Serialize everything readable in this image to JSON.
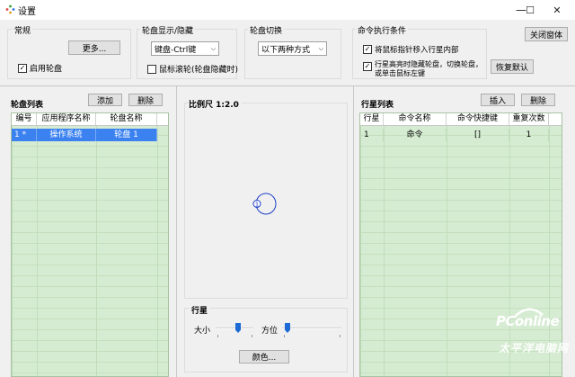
{
  "window": {
    "title": "设置",
    "minimize": "—",
    "maximize": "☐",
    "close": "✕"
  },
  "general": {
    "label": "常规",
    "more_button": "更多...",
    "enable_label": "启用轮盘",
    "enable_checked": true
  },
  "display": {
    "label": "轮盘显示/隐藏",
    "hotkey_value": "键盘-Ctrl键",
    "wheel_label": "鼠标滚轮(轮盘隐藏时)",
    "wheel_checked": false
  },
  "switch": {
    "label": "轮盘切换",
    "mode_value": "以下两种方式"
  },
  "exec": {
    "label": "命令执行条件",
    "opt1": "将鼠标指针移入行星内部",
    "opt1_checked": true,
    "opt2_line1": "行星高亮时隐藏轮盘，切换轮盘，",
    "opt2_line2": "或单击鼠标左键",
    "opt2_checked": true
  },
  "close_window_button": "关闭窗体",
  "restore_default_button": "恢复默认",
  "wheel_list": {
    "title": "轮盘列表",
    "add_button": "添加",
    "delete_button": "删除",
    "columns": [
      "编号",
      "应用程序名称",
      "轮盘名称"
    ],
    "rows": [
      {
        "id": "1 *",
        "app": "操作系统",
        "wheel": "轮盘 1"
      }
    ]
  },
  "preview": {
    "scale_label": "比例尺 1:2.0",
    "planet_number": "1"
  },
  "planet": {
    "title": "行星",
    "size_label": "大小",
    "direction_label": "方位",
    "color_button": "颜色...",
    "size_value": 0.6,
    "direction_value": 0.05
  },
  "planet_list": {
    "title": "行星列表",
    "insert_button": "插入",
    "delete_button": "删除",
    "columns": [
      "行星",
      "命令名称",
      "命令快捷键",
      "重复次数"
    ],
    "rows": [
      {
        "planet": "1",
        "name": "命令",
        "hotkey": "[]",
        "repeat": "1"
      }
    ]
  },
  "watermark": {
    "brand": "PConline",
    "sub": "太平洋电脑网"
  },
  "colors": {
    "selection": "#3b82f0",
    "grid_bg": "#d6ecd2",
    "accent": "#1e6bd6"
  }
}
